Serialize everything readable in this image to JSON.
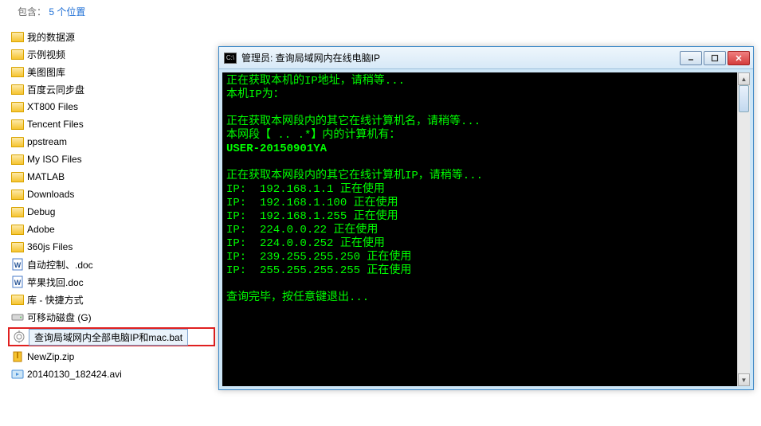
{
  "explorer": {
    "header_prefix": "包含：",
    "header_count": "5 个位置",
    "items": [
      {
        "label": "我的数据源",
        "type": "folder"
      },
      {
        "label": "示例视频",
        "type": "folder"
      },
      {
        "label": "美图图库",
        "type": "folder"
      },
      {
        "label": "百度云同步盘",
        "type": "folder"
      },
      {
        "label": "XT800 Files",
        "type": "folder"
      },
      {
        "label": "Tencent Files",
        "type": "folder"
      },
      {
        "label": "ppstream",
        "type": "folder"
      },
      {
        "label": "My ISO Files",
        "type": "folder"
      },
      {
        "label": "MATLAB",
        "type": "folder"
      },
      {
        "label": "Downloads",
        "type": "folder"
      },
      {
        "label": "Debug",
        "type": "folder"
      },
      {
        "label": "Adobe",
        "type": "folder"
      },
      {
        "label": "360js Files",
        "type": "folder"
      },
      {
        "label": "自动控制、.doc",
        "type": "doc"
      },
      {
        "label": "苹果找回.doc",
        "type": "doc"
      },
      {
        "label": "库 - 快捷方式",
        "type": "folder"
      },
      {
        "label": "可移动磁盘 (G)",
        "type": "drive"
      }
    ],
    "highlighted": {
      "label": "查询局域网内全部电脑IP和mac.bat",
      "type": "bat"
    },
    "after_items": [
      {
        "label": "NewZip.zip",
        "type": "zip"
      },
      {
        "label": "20140130_182424.avi",
        "type": "video"
      }
    ]
  },
  "console": {
    "title": "管理员:  查询局域网内在线电脑IP",
    "lines": [
      "正在获取本机的IP地址，请稍等...",
      "本机IP为：",
      "",
      "正在获取本网段内的其它在线计算机名，请稍等...",
      "本网段【 .. .*】内的计算机有：",
      "USER-20150901YA",
      "",
      "正在获取本网段内的其它在线计算机IP，请稍等...",
      "IP:  192.168.1.1 正在使用",
      "IP:  192.168.1.100 正在使用",
      "IP:  192.168.1.255 正在使用",
      "IP:  224.0.0.22 正在使用",
      "IP:  224.0.0.252 正在使用",
      "IP:  239.255.255.250 正在使用",
      "IP:  255.255.255.255 正在使用",
      "",
      "查询完毕，按任意键退出..."
    ],
    "bold_line_index": 5,
    "app_icon_text": "C:\\"
  }
}
